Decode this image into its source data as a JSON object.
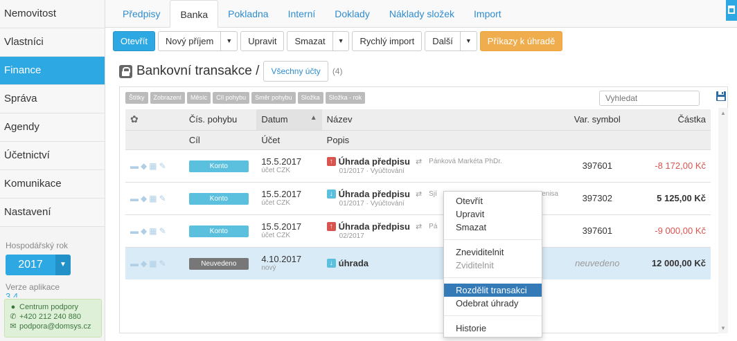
{
  "sidebar": {
    "items": [
      {
        "label": "Nemovitost",
        "active": false
      },
      {
        "label": "Vlastníci",
        "active": false
      },
      {
        "label": "Finance",
        "active": true
      },
      {
        "label": "Správa",
        "active": false
      },
      {
        "label": "Agendy",
        "active": false
      },
      {
        "label": "Účetnictví",
        "active": false
      },
      {
        "label": "Komunikace",
        "active": false
      },
      {
        "label": "Nastavení",
        "active": false
      }
    ],
    "fiscal_year_label": "Hospodářský rok",
    "fiscal_year": "2017",
    "version_label": "Verze aplikace",
    "version_value": "3.4",
    "support": {
      "title": "Centrum podpory",
      "phone": "+420 212 240 880",
      "email": "podpora@domsys.cz"
    }
  },
  "tabs": [
    "Předpisy",
    "Banka",
    "Pokladna",
    "Interní",
    "Doklady",
    "Náklady složek",
    "Import"
  ],
  "active_tab": 1,
  "toolbar": {
    "open": "Otevřít",
    "new_income": "Nový příjem",
    "edit": "Upravit",
    "delete": "Smazat",
    "quick_import": "Rychlý import",
    "more": "Další",
    "payment_orders": "Příkazy k úhradě"
  },
  "page": {
    "title": "Bankovní transakce /",
    "accounts_button": "Všechny účty",
    "count": "(4)"
  },
  "filters": [
    "Štítky",
    "Zobrazení",
    "Měsíc",
    "Cíl pohybu",
    "Směr pohybu",
    "Složka",
    "Složka - rok"
  ],
  "search": {
    "placeholder": "Vyhledat"
  },
  "table": {
    "headers": {
      "num": "Čís. pohybu",
      "date": "Datum",
      "name": "Název",
      "var": "Var. symbol",
      "amount": "Částka",
      "target": "Cíl",
      "account": "Účet",
      "desc": "Popis"
    },
    "rows": [
      {
        "target": "Konto",
        "target_style": "info",
        "date": "15.5.2017",
        "account": "účet CZK",
        "direction": "out",
        "name": "Úhrada předpisu",
        "party": "Pánková Markéta PhDr.",
        "desc": "01/2017 · Vyúčtování",
        "var": "397601",
        "amount": "-8 172,00 Kč",
        "amount_sign": "neg"
      },
      {
        "target": "Konto",
        "target_style": "info",
        "date": "15.5.2017",
        "account": "účet CZK",
        "direction": "in",
        "name": "Úhrada předpisu",
        "party": "Sjí",
        "party_tail": "Denisa",
        "desc": "01/2017 · Vyúčtování",
        "var": "397302",
        "amount": "5 125,00 Kč",
        "amount_sign": "pos"
      },
      {
        "target": "Konto",
        "target_style": "info",
        "date": "15.5.2017",
        "account": "účet CZK",
        "direction": "out",
        "name": "Úhrada předpisu",
        "party": "Pá",
        "desc": "02/2017",
        "var": "397601",
        "amount": "-9 000,00 Kč",
        "amount_sign": "neg"
      },
      {
        "target": "Neuvedeno",
        "target_style": "dark",
        "date": "4.10.2017",
        "account": "nový",
        "direction": "in",
        "name": "úhrada",
        "party": "",
        "desc": "",
        "var": "neuvedeno",
        "amount": "12 000,00 Kč",
        "amount_sign": "pos",
        "selected": true
      }
    ]
  },
  "context_menu": {
    "group1": [
      "Otevřít",
      "Upravit",
      "Smazat"
    ],
    "group2": [
      {
        "label": "Zneviditelnit",
        "disabled": false
      },
      {
        "label": "Zviditelnit",
        "disabled": true
      }
    ],
    "group3": [
      {
        "label": "Rozdělit transakci",
        "hover": true
      },
      {
        "label": "Odebrat úhrady",
        "hover": false
      }
    ],
    "group4": [
      "Historie"
    ]
  },
  "colors": {
    "accent": "#2ea8e2",
    "orange": "#f0ad4e",
    "negative": "#d9534f",
    "selected_row": "#d9ebf7"
  }
}
